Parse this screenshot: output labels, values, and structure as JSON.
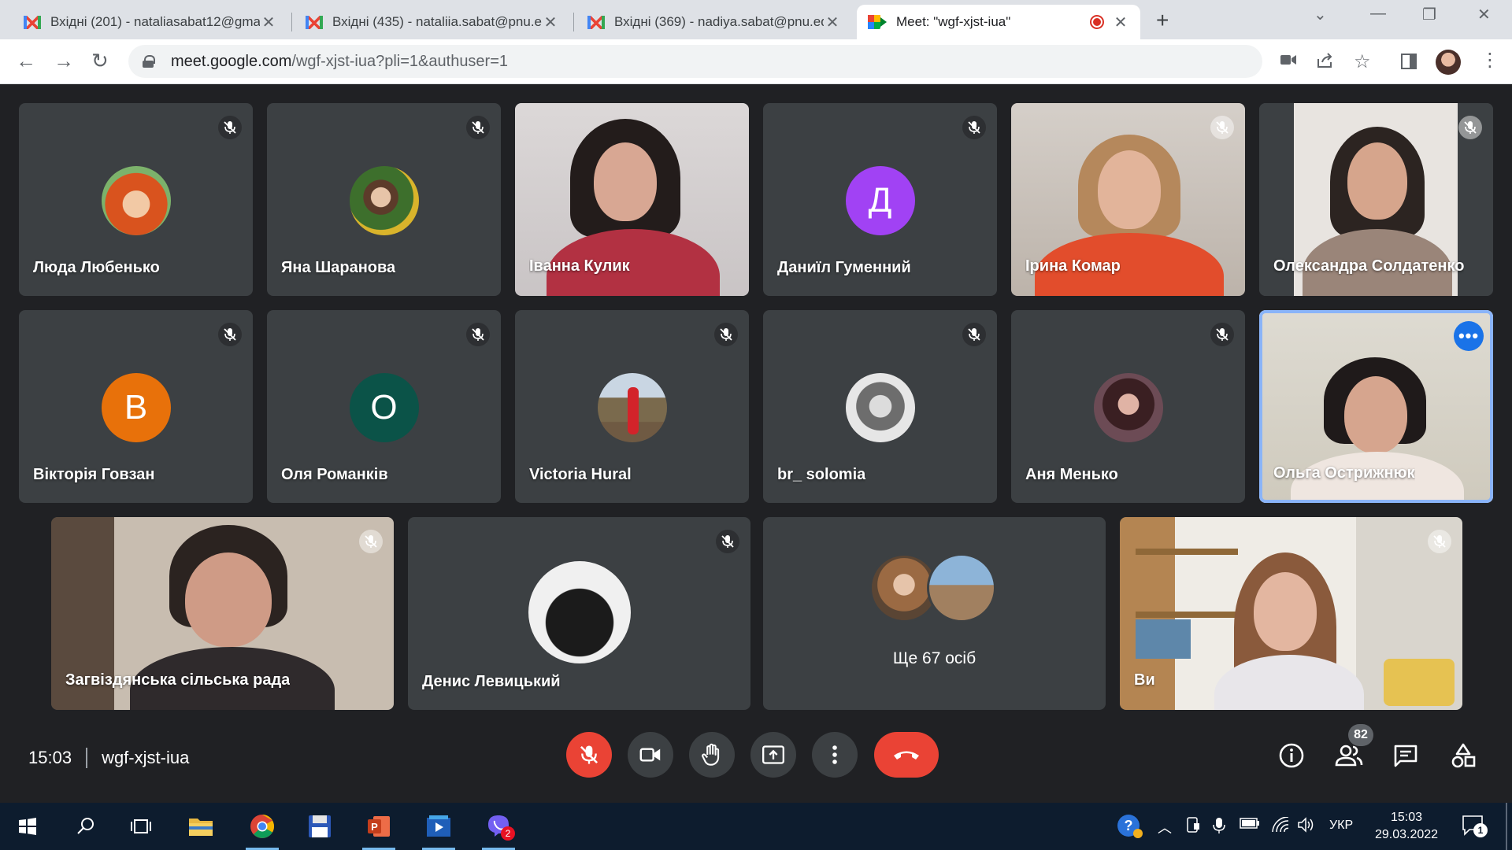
{
  "browser": {
    "tabs": [
      {
        "title": "Вхідні (201) - nataliasabat12@gmail.com",
        "icon": "gmail-icon"
      },
      {
        "title": "Вхідні (435) - nataliia.sabat@pnu.edu.ua",
        "icon": "gmail-icon"
      },
      {
        "title": "Вхідні (369) - nadiya.sabat@pnu.edu.ua",
        "icon": "gmail-icon"
      },
      {
        "title": "Meet: \"wgf-xjst-iua\"",
        "icon": "meet-icon"
      }
    ],
    "new_tab": "+",
    "url_host": "meet.google.com",
    "url_path": "/wgf-xjst-iua?pli=1&authuser=1"
  },
  "meet": {
    "tiles": [
      {
        "name": "Люда Любенько"
      },
      {
        "name": "Яна Шаранова"
      },
      {
        "name": "Іванна Кулик"
      },
      {
        "name": "Даниїл Гуменний",
        "initial": "Д"
      },
      {
        "name": "Ірина Комар"
      },
      {
        "name": "Олександра Солдатенко"
      },
      {
        "name": "Вікторія Говзан",
        "initial": "В"
      },
      {
        "name": "Оля Романків",
        "initial": "О"
      },
      {
        "name": "Victoria Hural"
      },
      {
        "name": "br_ solomia"
      },
      {
        "name": "Аня Менько"
      },
      {
        "name": "Ольга Острижнюк"
      },
      {
        "name": "Загвіздянська сільська рада"
      },
      {
        "name": "Денис Левицький"
      },
      {
        "name": "Ще 67 осіб"
      },
      {
        "name": "Ви"
      }
    ],
    "more_options": "•••",
    "time": "15:03",
    "meeting_code": "wgf-xjst-iua",
    "participants_count": "82"
  },
  "taskbar": {
    "language": "УКР",
    "time": "15:03",
    "date": "29.03.2022",
    "viber_badge": "2",
    "notifications_badge": "1"
  },
  "colors": {
    "meet_bg": "#202124",
    "tile_bg": "#3c4043",
    "end_call": "#ea4335",
    "active_speaker": "#8ab4f8",
    "avatar_d": "#a142f4",
    "avatar_v": "#e8710a",
    "avatar_o": "#0b5348"
  }
}
